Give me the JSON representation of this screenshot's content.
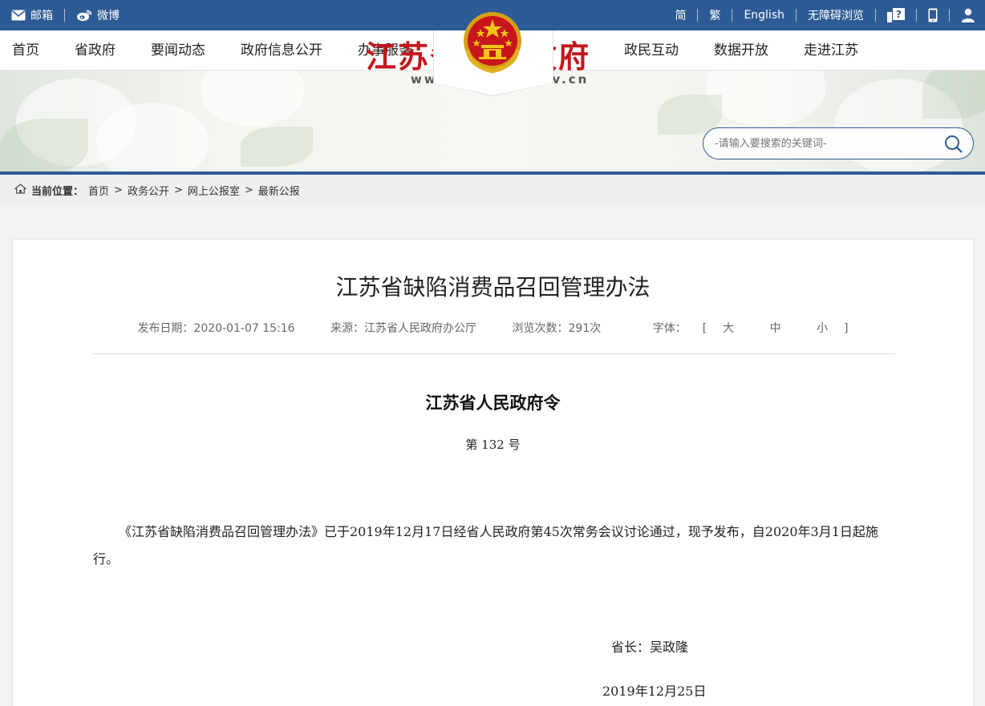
{
  "topbar": {
    "left": [
      {
        "icon": "mail-icon",
        "label": "邮箱"
      },
      {
        "icon": "weibo-icon",
        "label": "微博"
      }
    ],
    "right": {
      "simplified": "简",
      "traditional": "繁",
      "english": "English",
      "accessible": "无障碍浏览",
      "help_icon": "help-icon",
      "mobile_icon": "mobile-icon",
      "user_icon": "user-icon"
    }
  },
  "nav": {
    "left": [
      "首页",
      "省政府",
      "要闻动态",
      "政府信息公开",
      "办事服务"
    ],
    "right": [
      "政民互动",
      "数据开放",
      "走进江苏"
    ]
  },
  "banner": {
    "title": "江苏省人民政府",
    "url": "www.jiangsu.gov.cn",
    "search_placeholder": "-请输入要搜索的关键词-"
  },
  "breadcrumb": {
    "label": "当前位置：",
    "items": [
      "首页",
      "政务公开",
      "网上公报室",
      "最新公报"
    ],
    "separator": ">"
  },
  "article": {
    "title": "江苏省缺陷消费品召回管理办法",
    "publish_date": "发布日期：2020-01-07 15:16",
    "source": "来源：江苏省人民政府办公厅",
    "views": "浏览次数：291次",
    "font_label": "字体：",
    "font_options": [
      "大",
      "中",
      "小"
    ],
    "order_title": "江苏省人民政府令",
    "order_number": "第 132 号",
    "body": "《江苏省缺陷消费品召回管理办法》已于2019年12月17日经省人民政府第45次常务会议讨论通过，现予发布，自2020年3月1日起施行。",
    "signature": "省长：吴政隆",
    "sign_date": "2019年12月25日"
  },
  "colors": {
    "primary": "#2d5b96",
    "title_red": "#c4161c"
  }
}
